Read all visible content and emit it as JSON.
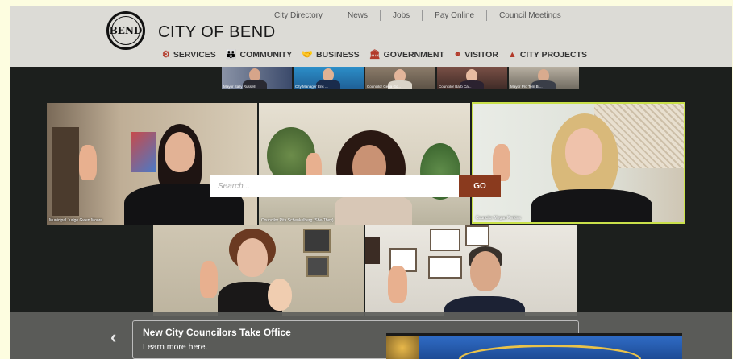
{
  "header": {
    "city_name": "CITY OF BEND",
    "seal_text": "BEND",
    "util_links": [
      "City Directory",
      "News",
      "Jobs",
      "Pay Online",
      "Council Meetings"
    ],
    "nav": [
      {
        "label": "SERVICES",
        "icon": "gear-icon"
      },
      {
        "label": "COMMUNITY",
        "icon": "family-icon"
      },
      {
        "label": "BUSINESS",
        "icon": "handshake-icon"
      },
      {
        "label": "GOVERNMENT",
        "icon": "building-icon"
      },
      {
        "label": "VISITOR",
        "icon": "binoculars-icon"
      },
      {
        "label": "CITY PROJECTS",
        "icon": "traffic-cone-icon"
      }
    ]
  },
  "thumbnails": [
    "Mayor Sally Russell",
    "City Manager Eric ...",
    "Councilor Gena Go...",
    "Councilor Barb Ca...",
    "Mayor Pro Tem Br..."
  ],
  "video_captions": {
    "judge": "Municipal Judge Gwen Moore",
    "rita": "Councilor Rita Schenkelberg (She/They)",
    "megan": "Councilor Megan Perkins"
  },
  "search": {
    "placeholder": "Search...",
    "button": "GO"
  },
  "slider": {
    "title": "New City Councilors Take Office",
    "link": "Learn more here.",
    "prev": "‹",
    "next": "›"
  }
}
